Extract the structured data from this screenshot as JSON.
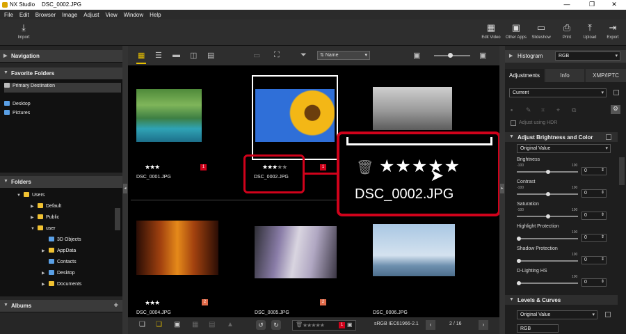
{
  "window": {
    "app": "NX Studio",
    "file": "DSC_0002.JPG",
    "controls": [
      "—",
      "❐",
      "✕"
    ]
  },
  "menu": [
    "File",
    "Edit",
    "Browser",
    "Image",
    "Adjust",
    "View",
    "Window",
    "Help"
  ],
  "toolbar": {
    "import": "Import",
    "right": [
      "Edit Video",
      "Other Apps",
      "Slideshow",
      "Print",
      "Upload",
      "Export"
    ]
  },
  "left": {
    "navigation": "Navigation",
    "favorites": "Favorite Folders",
    "favorite_items": [
      "Primary Destination",
      "Desktop",
      "Pictures"
    ],
    "folders": "Folders",
    "tree": [
      "Users",
      "Default",
      "Public",
      "user",
      "3D Objects",
      "AppData",
      "Contacts",
      "Desktop",
      "Documents"
    ],
    "albums": "Albums"
  },
  "center": {
    "sort": "Name",
    "thumbs": [
      {
        "name": "DSC_0001.JPG",
        "label": "1",
        "rating": 3
      },
      {
        "name": "DSC_0002.JPG",
        "label": "1",
        "rating": 3
      },
      {
        "name": "",
        "label": "",
        "rating": 0
      },
      {
        "name": "DSC_0004.JPG",
        "label": "2",
        "rating": 3
      },
      {
        "name": "DSC_0005.JPG",
        "label": "2",
        "rating": 0
      },
      {
        "name": "DSC_0006.JPG",
        "label": "",
        "rating": 0
      }
    ],
    "zoom_name": "DSC_0002.JPG",
    "zoom_rating": 3,
    "zoom_max": 5,
    "colorspace": "sRGB IEC61966-2.1",
    "page": "2 / 16",
    "bottom_label": "1"
  },
  "right": {
    "histogram": "Histogram",
    "histogram_mode": "RGB",
    "tabs": [
      "Adjustments",
      "Info",
      "XMP/IPTC"
    ],
    "preset": "Current",
    "adjust_hdr": "Adjust using HDR",
    "brightness_section": "Adjust Brightness and Color",
    "brightness_preset": "Original Value",
    "sliders": [
      {
        "label": "Brightness",
        "min": "-100",
        "max": "100",
        "value": "0"
      },
      {
        "label": "Contrast",
        "min": "-100",
        "max": "100",
        "value": "0"
      },
      {
        "label": "Saturation",
        "min": "-100",
        "max": "100",
        "value": "0"
      },
      {
        "label": "Highlight Protection",
        "min": "",
        "max": "100",
        "value": "0"
      },
      {
        "label": "Shadow Protection",
        "min": "",
        "max": "100",
        "value": "0"
      },
      {
        "label": "D-Lighting HS",
        "min": "",
        "max": "100",
        "value": "0"
      }
    ],
    "levels_section": "Levels & Curves",
    "levels_preset": "Original Value",
    "levels_mode": "RGB"
  }
}
